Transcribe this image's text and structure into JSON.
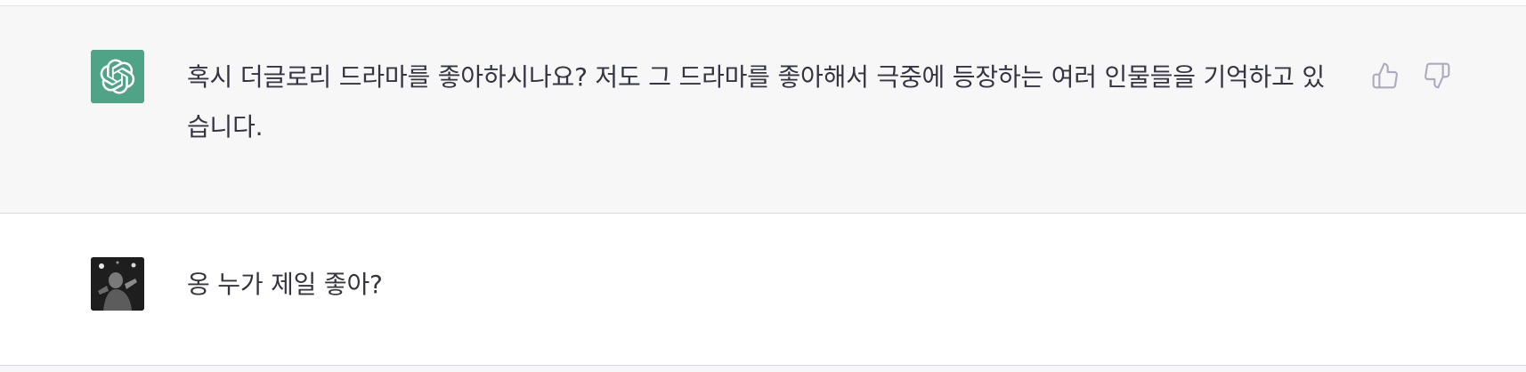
{
  "conversation": {
    "messages": [
      {
        "role": "assistant",
        "avatar_icon": "openai-logo-icon",
        "text": "혹시 더글로리 드라마를 좋아하시나요? 저도 그 드라마를 좋아해서 극중에 등장하는 여러 인물들을 기억하고 있습니다.",
        "feedback": {
          "thumbs_up_icon": "thumbs-up-icon",
          "thumbs_down_icon": "thumbs-down-icon"
        }
      },
      {
        "role": "user",
        "avatar_icon": "user-photo-avatar",
        "text": "옹 누가 제일 좋아?"
      }
    ]
  },
  "colors": {
    "assistant_bg": "#f7f7f8",
    "user_bg": "#ffffff",
    "avatar_green": "#4fa487",
    "text": "#343541",
    "icon": "#acacbe"
  }
}
